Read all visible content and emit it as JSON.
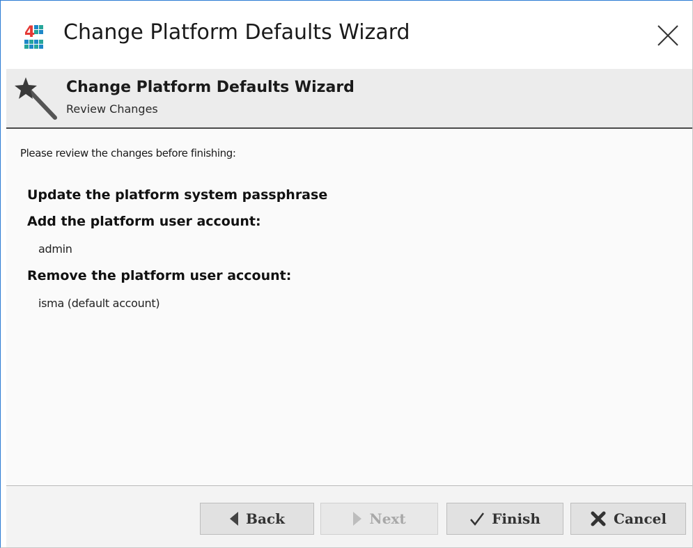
{
  "window": {
    "title": "Change Platform Defaults Wizard",
    "close_glyph": "×"
  },
  "header": {
    "title": "Change Platform Defaults Wizard",
    "subtitle": "Review Changes",
    "icon": "magic-wand-icon"
  },
  "content": {
    "intro": "Please review the changes before finishing:",
    "sections": [
      {
        "heading": "Update the platform system passphrase"
      },
      {
        "heading": "Add the platform user account:",
        "detail": "admin"
      },
      {
        "heading": "Remove the platform user account:",
        "detail": "isma (default account)"
      }
    ]
  },
  "buttons": {
    "back": {
      "label": "Back",
      "icon": "left-arrow-icon",
      "enabled": true
    },
    "next": {
      "label": "Next",
      "icon": "right-arrow-icon",
      "enabled": false
    },
    "finish": {
      "label": "Finish",
      "icon": "checkmark-icon",
      "enabled": true
    },
    "cancel": {
      "label": "Cancel",
      "icon": "x-icon",
      "enabled": true
    }
  },
  "colors": {
    "window_border": "#2b7bd4",
    "header_bg": "#ececec",
    "button_bg": "#e1e1e1",
    "disabled_text": "#a8a8a8",
    "app_icon_red": "#e53935",
    "app_icon_blue": "#1e88c8",
    "app_icon_teal": "#26a69a"
  }
}
